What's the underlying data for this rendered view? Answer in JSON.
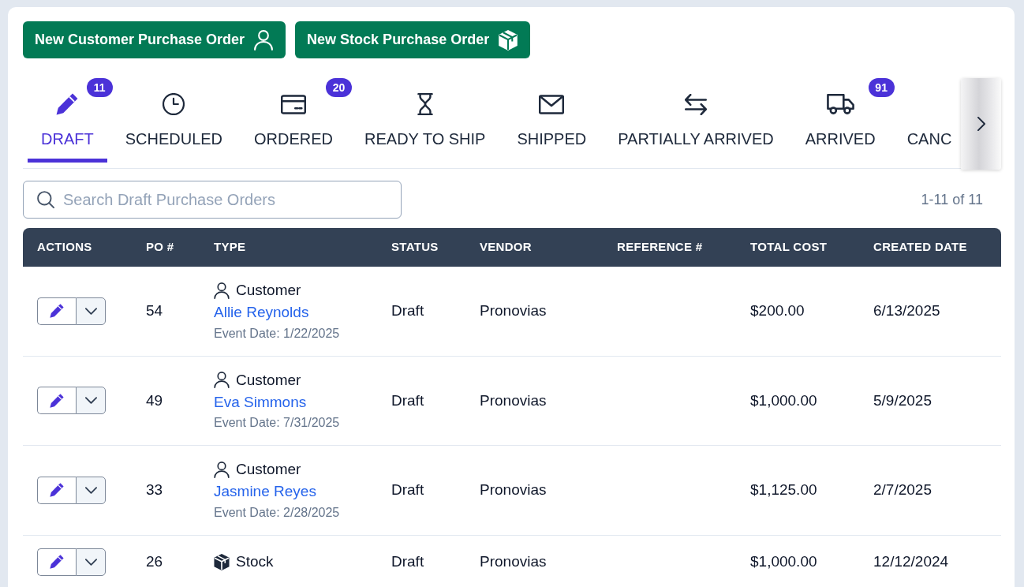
{
  "toolbar": {
    "buttons": [
      {
        "label": "New Customer Purchase Order",
        "kind": "customer"
      },
      {
        "label": "New Stock Purchase Order",
        "kind": "stock"
      }
    ]
  },
  "tabs": [
    {
      "label": "DRAFT",
      "kind": "draft",
      "selected": true,
      "count": "11"
    },
    {
      "label": "SCHEDULED",
      "kind": "scheduled",
      "selected": false
    },
    {
      "label": "ORDERED",
      "kind": "ordered",
      "selected": false,
      "count": "20"
    },
    {
      "label": "READY TO SHIP",
      "kind": "ready_to_ship",
      "selected": false
    },
    {
      "label": "SHIPPED",
      "kind": "shipped",
      "selected": false
    },
    {
      "label": "PARTIALLY ARRIVED",
      "kind": "partially_arrived",
      "selected": false
    },
    {
      "label": "ARRIVED",
      "kind": "arrived",
      "selected": false,
      "count": "91"
    },
    {
      "label": "CANC",
      "selected": false
    }
  ],
  "search": {
    "placeholder": "Search Draft Purchase Orders"
  },
  "result_count": "1-11 of 11",
  "table": {
    "columns": [
      "ACTIONS",
      "PO #",
      "TYPE",
      "STATUS",
      "VENDOR",
      "REFERENCE #",
      "TOTAL COST",
      "CREATED DATE"
    ],
    "rows": [
      {
        "po_number": "54",
        "type": {
          "kind": "customer",
          "label": "Customer",
          "customer": "Allie Reynolds",
          "event_date": "Event Date: 1/22/2025"
        },
        "status": "Draft",
        "vendor": "Pronovias",
        "total_cost": "$200.00",
        "created_date": "6/13/2025"
      },
      {
        "po_number": "49",
        "type": {
          "kind": "customer",
          "label": "Customer",
          "customer": "Eva Simmons",
          "event_date": "Event Date: 7/31/2025"
        },
        "status": "Draft",
        "vendor": "Pronovias",
        "total_cost": "$1,000.00",
        "created_date": "5/9/2025"
      },
      {
        "po_number": "33",
        "type": {
          "kind": "customer",
          "label": "Customer",
          "customer": "Jasmine Reyes",
          "event_date": "Event Date: 2/28/2025"
        },
        "status": "Draft",
        "vendor": "Pronovias",
        "total_cost": "$1,125.00",
        "created_date": "2/7/2025"
      },
      {
        "po_number": "26",
        "type": {
          "kind": "stock",
          "label": "Stock"
        },
        "status": "Draft",
        "vendor": "Pronovias",
        "total_cost": "$1,000.00",
        "created_date": "12/12/2024"
      }
    ]
  }
}
